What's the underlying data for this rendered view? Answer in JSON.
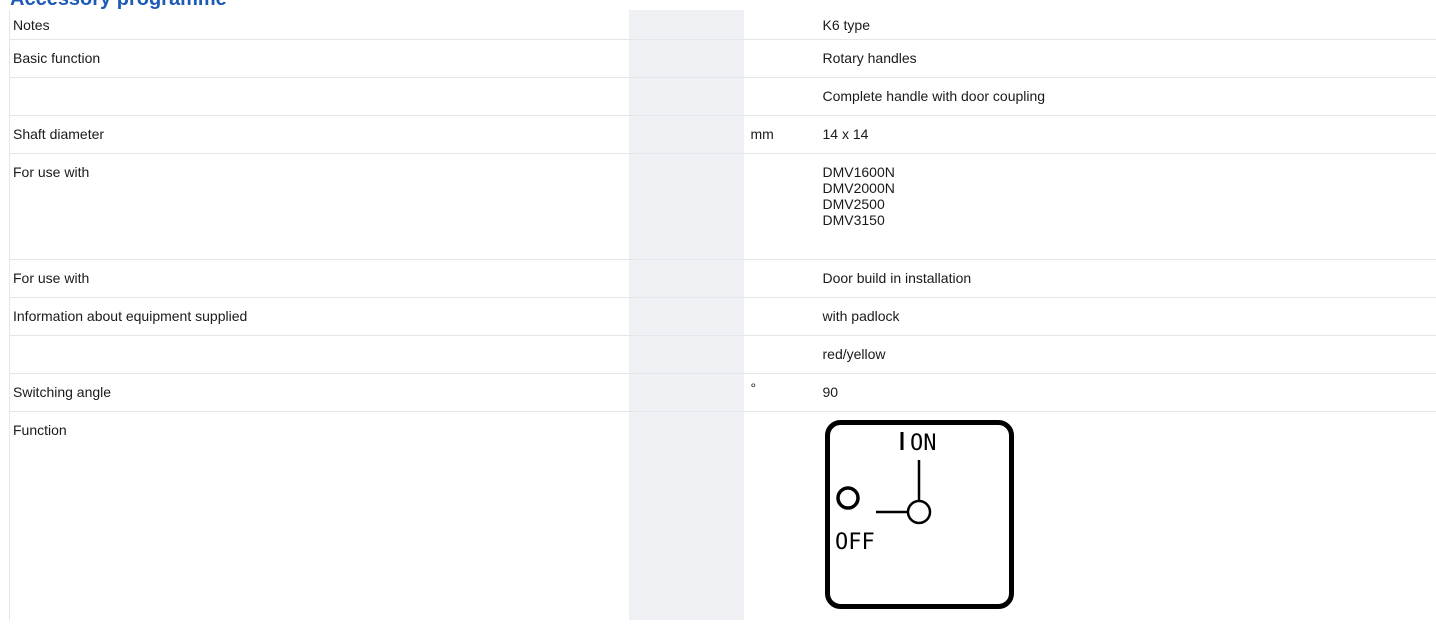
{
  "page": {
    "section_title": "Accessory programme"
  },
  "table": {
    "rows": [
      {
        "label": "Notes",
        "unit": "",
        "value": "K6 type"
      },
      {
        "label": "Basic function",
        "unit": "",
        "value": "Rotary handles"
      },
      {
        "label": "",
        "unit": "",
        "value": "Complete handle with door coupling"
      },
      {
        "label": "Shaft diameter",
        "unit": "mm",
        "value": "14 x 14"
      },
      {
        "label": "For use with",
        "unit": "",
        "values": [
          "DMV1600N",
          "DMV2000N",
          "DMV2500",
          "DMV3150"
        ]
      },
      {
        "label": "For use with",
        "unit": "",
        "value": "Door build in installation"
      },
      {
        "label": "Information about equipment supplied",
        "unit": "",
        "value": "with padlock"
      },
      {
        "label": "",
        "unit": "",
        "value": "red/yellow"
      },
      {
        "label": "Switching angle",
        "unit": "°",
        "value": "90"
      },
      {
        "label": "Function",
        "unit": ""
      }
    ]
  },
  "diagram": {
    "on_label": "ON",
    "off_label": "OFF",
    "on_symbol_icon": "line-icon",
    "off_symbol_icon": "circle-icon"
  }
}
